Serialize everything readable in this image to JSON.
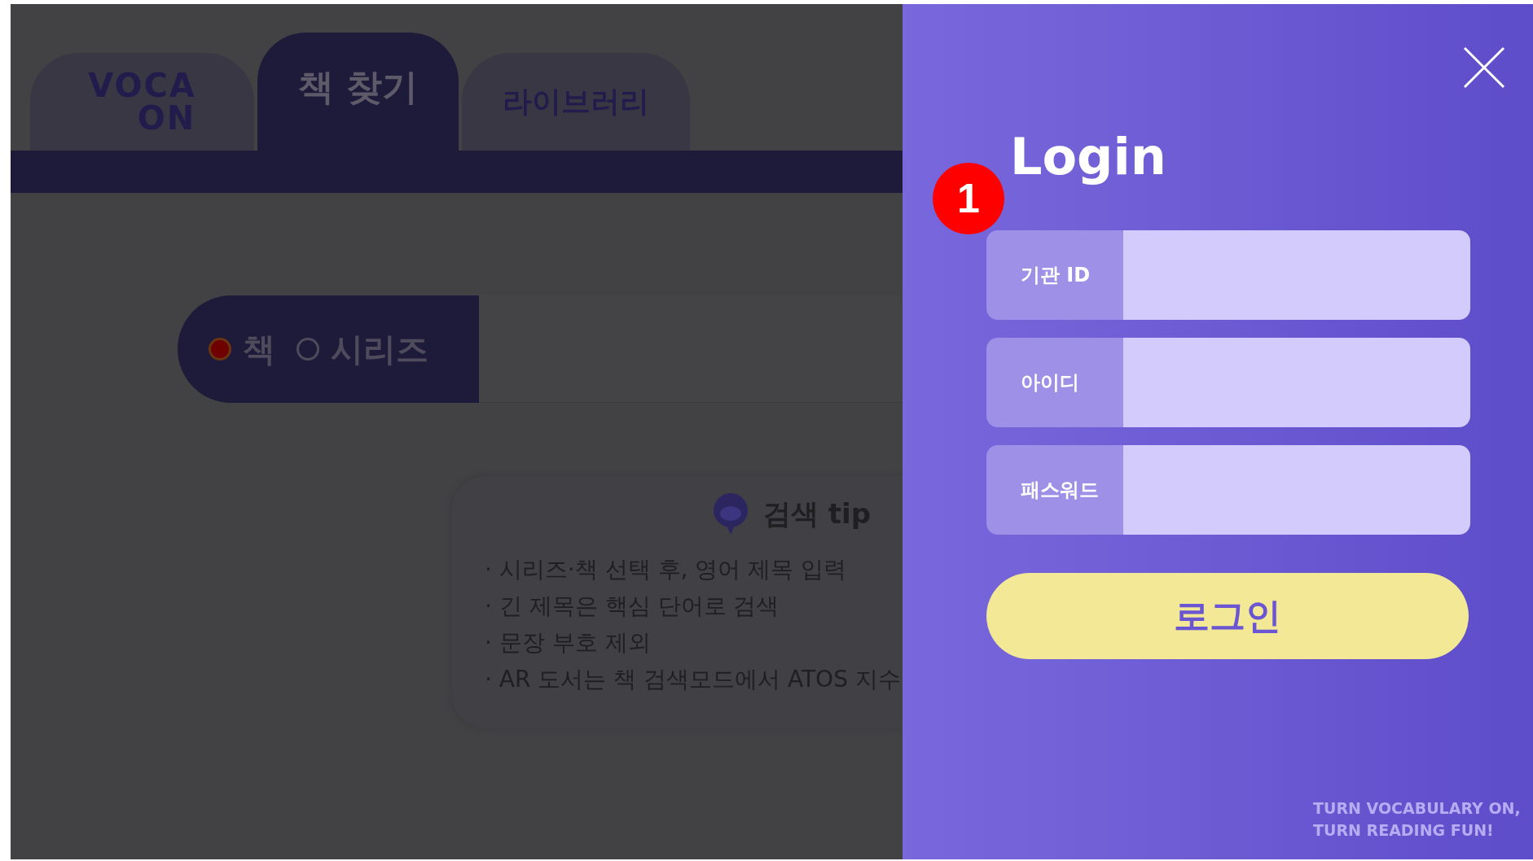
{
  "logo": {
    "line1": "VOCA",
    "line2": "ON"
  },
  "tabs": [
    {
      "label": "책 찾기",
      "selected": true
    },
    {
      "label": "라이브러리",
      "selected": false
    }
  ],
  "search": {
    "options": [
      {
        "label": "책",
        "selected": true
      },
      {
        "label": "시리즈",
        "selected": false
      }
    ]
  },
  "tip": {
    "title": "검색 tip",
    "items": [
      "·  시리즈·책 선택 후, 영어 제목 입력",
      "·  긴 제목은 핵심 단어로 검색",
      "·  문장 부호 제외",
      "· AR 도서는 책 검색모드에서 ATOS 지수"
    ]
  },
  "login": {
    "title": "Login",
    "annotation_badge": "1",
    "fields": [
      {
        "label": "기관 ID"
      },
      {
        "label": "아이디"
      },
      {
        "label": "패스워드"
      }
    ],
    "button": "로그인",
    "slogan": [
      "TURN VOCABULARY ON,",
      "TURN READING FUN!"
    ]
  }
}
